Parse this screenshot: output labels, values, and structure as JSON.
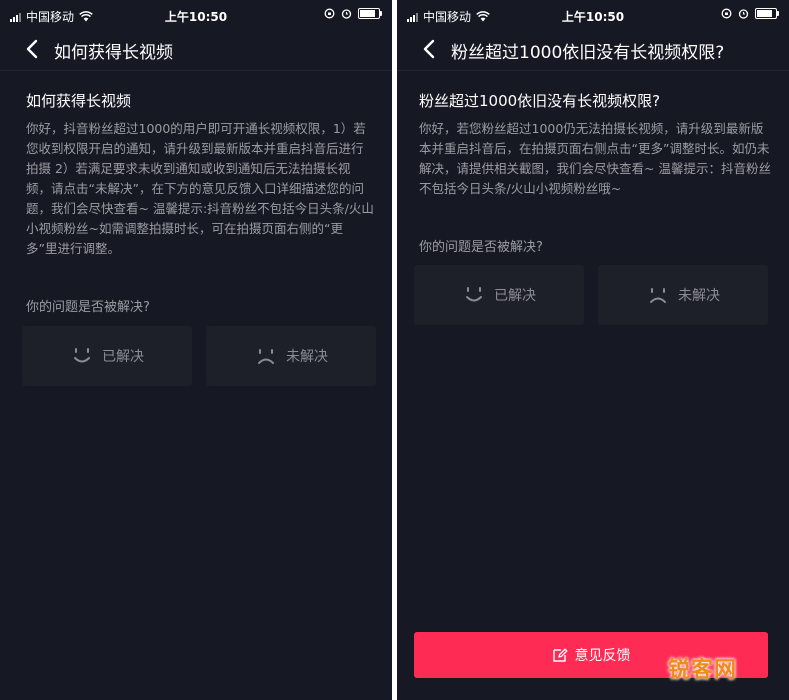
{
  "left_screen": {
    "status_bar": {
      "carrier": "中国移动",
      "time": "上午10:50"
    },
    "nav": {
      "title": "如何获得长视频"
    },
    "article": {
      "title": "如何获得长视频",
      "body": "你好，抖音粉丝超过1000的用户即可开通长视频权限，1）若您收到权限开启的通知，请升级到最新版本并重启抖音后进行拍摄 2）若满足要求未收到通知或收到通知后无法拍摄长视频，请点击“未解决”，在下方的意见反馈入口详细描述您的问题，我们会尽快查看~ 温馨提示:抖音粉丝不包括今日头条/火山小视频粉丝~如需调整拍摄时长，可在拍摄页面右侧的“更多”里进行调整。"
    },
    "question": "你的问题是否被解决?",
    "buttons": {
      "solved": "已解决",
      "unsolved": "未解决"
    }
  },
  "right_screen": {
    "status_bar": {
      "carrier": "中国移动",
      "time": "上午10:50"
    },
    "nav": {
      "title": "粉丝超过1000依旧没有长视频权限?"
    },
    "article": {
      "title": "粉丝超过1000依旧没有长视频权限?",
      "body": "你好，若您粉丝超过1000仍无法拍摄长视频，请升级到最新版本并重启抖音后，在拍摄页面右侧点击“更多”调整时长。如仍未解决，请提供相关截图，我们会尽快查看~ 温馨提示：抖音粉丝不包括今日头条/火山小视频粉丝哦~"
    },
    "question": "你的问题是否被解决?",
    "buttons": {
      "solved": "已解决",
      "unsolved": "未解决"
    },
    "feedback": {
      "label": "意见反馈"
    }
  },
  "watermark": "锐客网",
  "colors": {
    "background": "#161823",
    "accent": "#fe2c55",
    "muted_text": "#9b9ca3",
    "button_bg": "#1e2029"
  },
  "icons": [
    "signal-icon",
    "wifi-icon",
    "battery-icon",
    "back-icon",
    "smile-icon",
    "frown-icon",
    "edit-icon"
  ]
}
